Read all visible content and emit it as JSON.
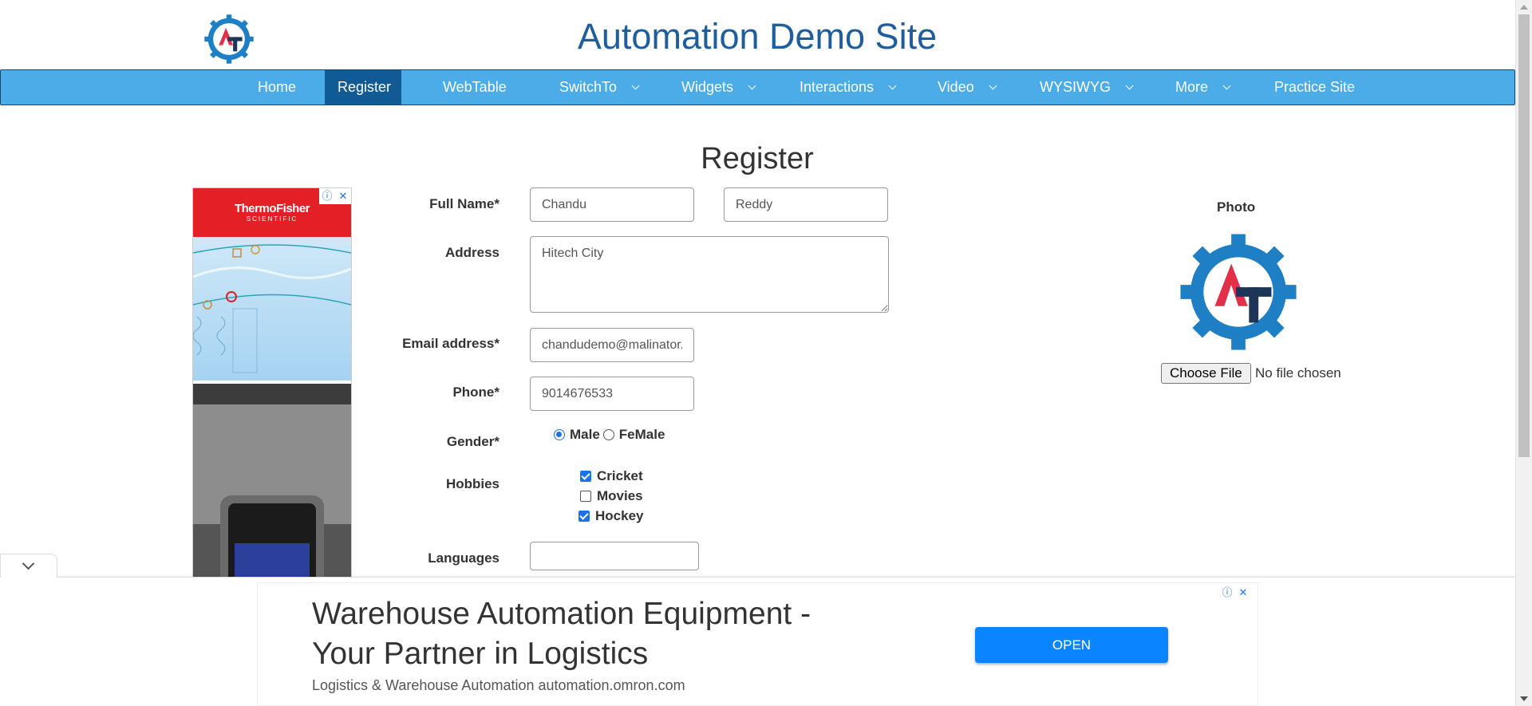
{
  "header": {
    "title": "Automation Demo Site"
  },
  "nav": {
    "items": [
      {
        "label": "Home"
      },
      {
        "label": "Register"
      },
      {
        "label": "WebTable"
      },
      {
        "label": "SwitchTo"
      },
      {
        "label": "Widgets"
      },
      {
        "label": "Interactions"
      },
      {
        "label": "Video"
      },
      {
        "label": "WYSIWYG"
      },
      {
        "label": "More"
      },
      {
        "label": "Practice Site"
      }
    ],
    "active": "Register",
    "bar_color": "#4bace8",
    "active_color": "#105b96"
  },
  "page": {
    "heading": "Register"
  },
  "form": {
    "full_name_label": "Full Name*",
    "first_name_value": "Chandu",
    "last_name_value": "Reddy",
    "address_label": "Address",
    "address_value": "Hitech City",
    "email_label": "Email address*",
    "email_value": "chandudemo@malinator.com",
    "phone_label": "Phone*",
    "phone_value": "9014676533",
    "gender_label": "Gender*",
    "gender_male": "Male",
    "gender_female": "FeMale",
    "gender_selected": "Male",
    "hobbies_label": "Hobbies",
    "hobby_cricket": "Cricket",
    "hobby_movies": "Movies",
    "hobby_hockey": "Hockey",
    "hobbies_checked": [
      "Cricket",
      "Hockey"
    ],
    "languages_label": "Languages",
    "languages_value": ""
  },
  "photo": {
    "label": "Photo",
    "choose_button": "Choose File",
    "file_status": "No file chosen"
  },
  "left_ad": {
    "brand_line1": "ThermoFisher",
    "brand_line2": "SCIENTIFIC"
  },
  "bottom_ad": {
    "headline": "Warehouse Automation Equipment - Your Partner in Logistics",
    "sub": "Logistics & Warehouse Automation automation.omron.com",
    "button": "OPEN",
    "button_color": "#0a84ff"
  },
  "icons": {
    "ad_info": "ⓘ",
    "ad_close": "✕"
  }
}
